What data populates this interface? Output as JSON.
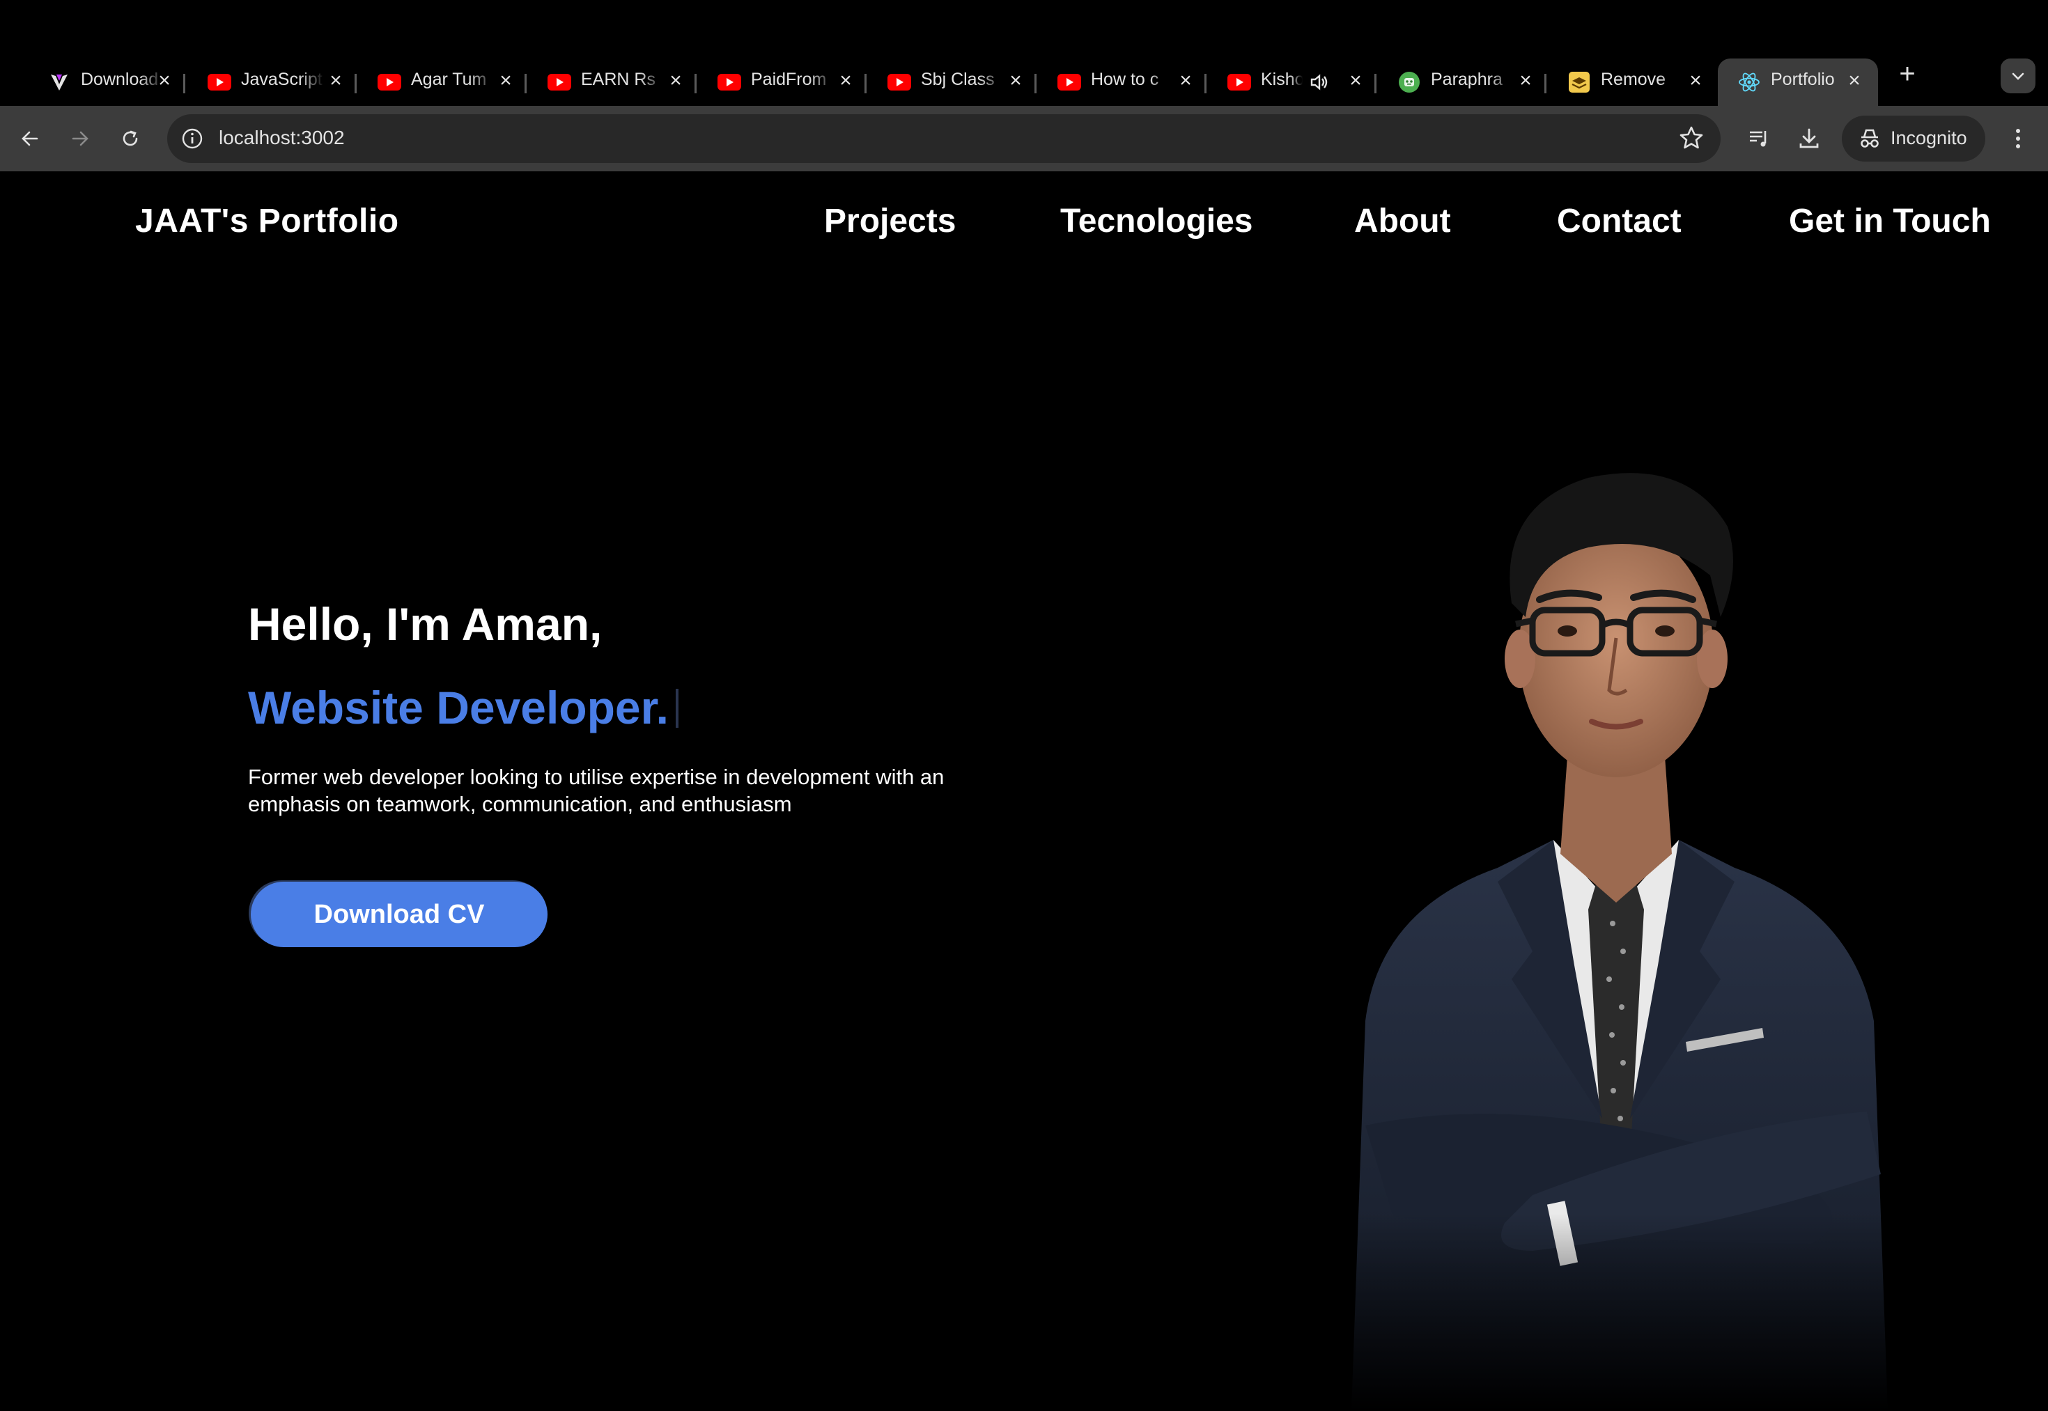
{
  "browser": {
    "tabs": [
      {
        "title": "Download",
        "icon": "vite-icon"
      },
      {
        "title": "JavaScript",
        "icon": "youtube-icon"
      },
      {
        "title": "Agar Tum",
        "icon": "youtube-icon"
      },
      {
        "title": "EARN Rs",
        "icon": "youtube-icon"
      },
      {
        "title": "PaidFrom",
        "icon": "youtube-icon"
      },
      {
        "title": "Sbj Class",
        "icon": "youtube-icon"
      },
      {
        "title": "How to c",
        "icon": "youtube-icon"
      },
      {
        "title": "Kisho",
        "icon": "youtube-icon",
        "audio": true
      },
      {
        "title": "Paraphra",
        "icon": "robot-icon"
      },
      {
        "title": "Remove",
        "icon": "stack-icon"
      },
      {
        "title": "Portfolio",
        "icon": "react-icon",
        "active": true
      }
    ],
    "url": "localhost:3002",
    "incognito_label": "Incognito"
  },
  "site": {
    "logo": "JAAT's Portfolio",
    "nav": [
      "Projects",
      "Tecnologies",
      "About",
      "Contact",
      "Get in Touch"
    ],
    "greeting": "Hello, I'm Aman,",
    "role": "Website Developer.",
    "bio_line1": "Former web developer looking to utilise expertise in development with an",
    "bio_line2": "emphasis on teamwork, communication, and enthusiasm",
    "cta": "Download CV"
  },
  "colors": {
    "accent": "#4a7ee6",
    "background": "#000000",
    "chrome": "#3c3c3c"
  }
}
